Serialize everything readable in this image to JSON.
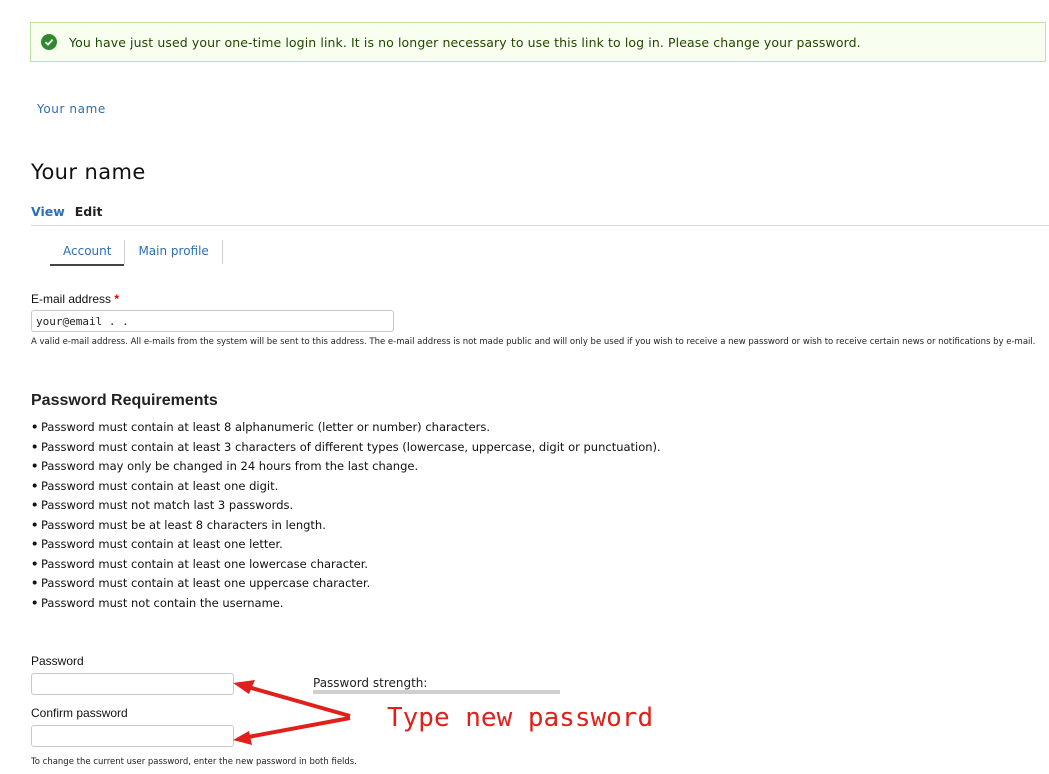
{
  "message": {
    "text": "You have just used your one-time login link. It is no longer necessary to use this link to log in. Please change your password.",
    "icon": "check-icon",
    "color": "#2f8a2f"
  },
  "breadcrumb": {
    "label": "Your name"
  },
  "page": {
    "title": "Your name"
  },
  "primary_tabs": {
    "view": "View",
    "edit": "Edit"
  },
  "secondary_tabs": {
    "account": "Account",
    "main_profile": "Main profile"
  },
  "email": {
    "label": "E-mail address",
    "required_mark": "*",
    "value": "your@email . .",
    "description": "A valid e-mail address. All e-mails from the system will be sent to this address. The e-mail address is not made public and will only be used if you wish to receive a new password or wish to receive certain news or notifications by e-mail."
  },
  "requirements": {
    "heading": "Password Requirements",
    "items": [
      "Password must contain at least 8 alphanumeric (letter or number) characters.",
      "Password must contain at least 3 characters of different types (lowercase, uppercase, digit or punctuation).",
      "Password may only be changed in 24 hours from the last change.",
      "Password must contain at least one digit.",
      "Password must not match last 3 passwords.",
      "Password must be at least 8 characters in length.",
      "Password must contain at least one letter.",
      "Password must contain at least one lowercase character.",
      "Password must contain at least one uppercase character.",
      "Password must not contain the username."
    ]
  },
  "password": {
    "label": "Password",
    "value": "",
    "strength_label": "Password strength:",
    "confirm_label": "Confirm password",
    "confirm_value": "",
    "description": "To change the current user password, enter the new password in both fields."
  },
  "annotation": {
    "text": "Type new password",
    "color": "#e0201a"
  }
}
